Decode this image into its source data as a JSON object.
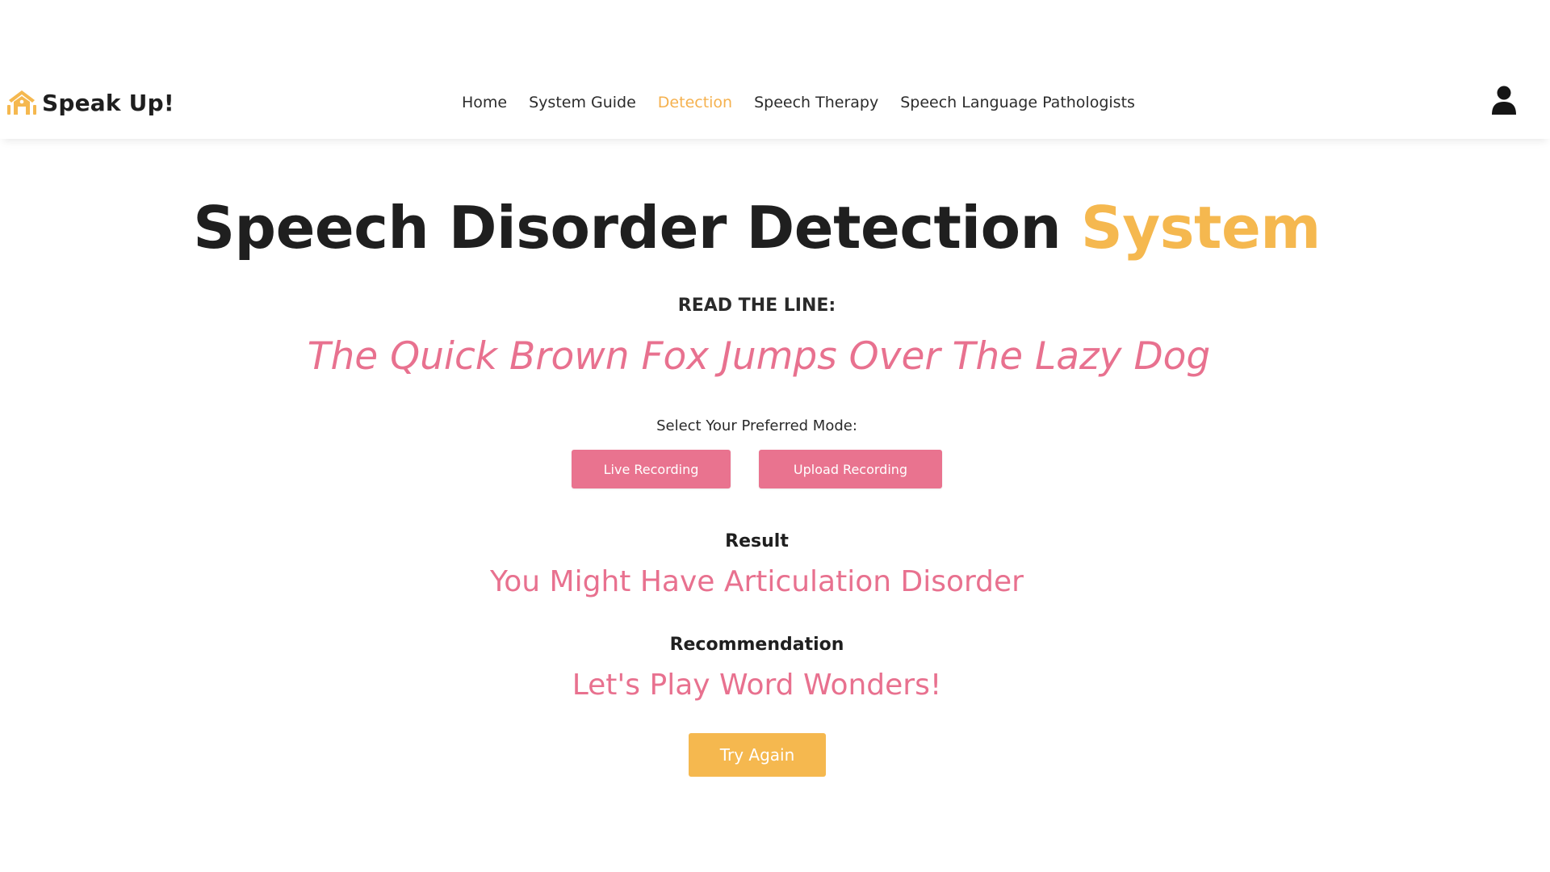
{
  "colors": {
    "accent_orange": "#f5b84f",
    "accent_pink": "#e8718f",
    "text_dark": "#1f1f1f"
  },
  "header": {
    "brand": {
      "icon": "house-hand-logo-icon",
      "name": "Speak Up!"
    },
    "nav": [
      {
        "label": "Home",
        "active": false
      },
      {
        "label": "System Guide",
        "active": false
      },
      {
        "label": "Detection",
        "active": true
      },
      {
        "label": "Speech Therapy",
        "active": false
      },
      {
        "label": "Speech Language Pathologists",
        "active": false
      }
    ],
    "user_icon": "user-icon"
  },
  "main": {
    "title_main": "Speech Disorder Detection ",
    "title_accent": "System",
    "read_label": "READ THE LINE:",
    "read_line": "The Quick Brown Fox Jumps Over The Lazy Dog",
    "mode_label": "Select Your Preferred Mode:",
    "mode_buttons": {
      "live": "Live Recording",
      "upload": "Upload Recording"
    },
    "result_label": "Result",
    "result_value": "You Might Have Articulation Disorder",
    "recommendation_label": "Recommendation",
    "recommendation_value": "Let's Play Word Wonders!",
    "try_again": "Try Again"
  }
}
